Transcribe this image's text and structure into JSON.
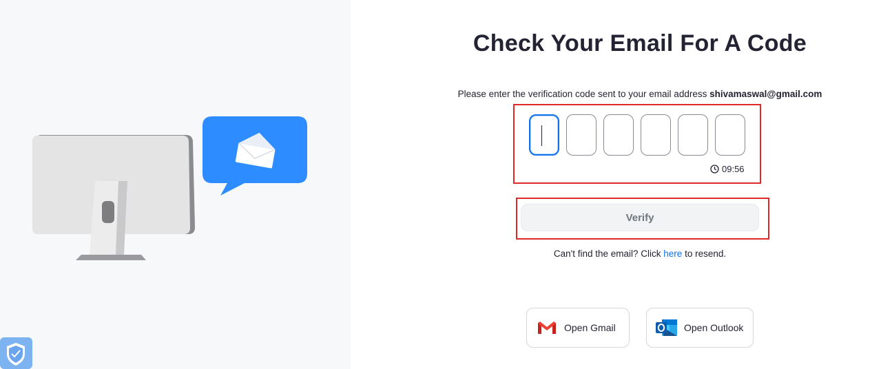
{
  "page": {
    "title": "Check Your Email For A Code",
    "subtitle_prefix": "Please enter the verification code sent to your email address",
    "email": "shivamaswal@gmail.com"
  },
  "code": {
    "digits": [
      "",
      "",
      "",
      "",
      "",
      ""
    ],
    "timer": "09:56"
  },
  "actions": {
    "verify_label": "Verify",
    "resend_prefix": "Can't find the email? Click",
    "resend_link": "here",
    "resend_suffix": "to resend.",
    "open_gmail_label": "Open Gmail",
    "open_outlook_label": "Open Outlook"
  },
  "icons": {
    "timer": "clock-icon",
    "gmail": "gmail-icon",
    "outlook": "outlook-icon",
    "shield": "shield-check-icon",
    "illustration": "monitor-envelope-illustration"
  },
  "colors": {
    "accent": "#0e72ed",
    "highlight": "#e02828",
    "chat_bubble": "#2d8cff",
    "left_panel_bg": "#f7f8fa"
  }
}
